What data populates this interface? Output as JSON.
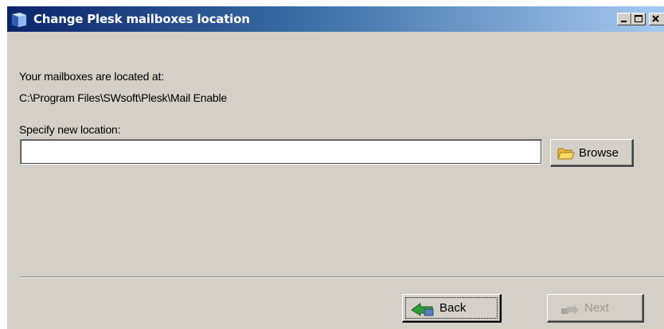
{
  "window": {
    "title": "Change Plesk mailboxes location",
    "icon": "plesk-app-icon",
    "controls": [
      "minimize-icon",
      "maximize-icon",
      "close-icon"
    ]
  },
  "content": {
    "located_label": "Your mailboxes are located at:",
    "current_path": "C:\\Program Files\\SWsoft\\Plesk\\Mail Enable",
    "specify_label": "Specify new location:",
    "new_location_value": "",
    "new_location_placeholder": ""
  },
  "buttons": {
    "browse": {
      "label": "Browse",
      "icon": "folder-icon"
    },
    "back": {
      "label": "Back",
      "icon": "back-arrow-icon",
      "enabled": true
    },
    "next": {
      "label": "Next",
      "icon": "next-arrow-icon",
      "enabled": false
    }
  },
  "colors": {
    "window_face": "#d4d0c8",
    "title_gradient_start": "#0a246a",
    "title_gradient_end": "#a6caf0",
    "disabled_text": "#9a978f"
  }
}
